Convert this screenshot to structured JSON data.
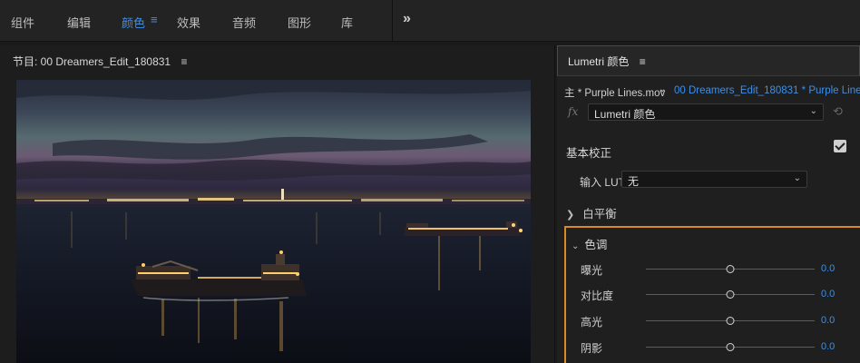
{
  "workspaces": {
    "tabs": [
      {
        "label": "组件"
      },
      {
        "label": "编辑"
      },
      {
        "label": "颜色"
      },
      {
        "label": "效果"
      },
      {
        "label": "音频"
      },
      {
        "label": "图形"
      },
      {
        "label": "库"
      }
    ],
    "active_index": 2,
    "menu_glyph": "≡",
    "more_glyph": "»"
  },
  "program": {
    "title": "节目: 00 Dreamers_Edit_180831",
    "menu_glyph": "≡"
  },
  "lumetri": {
    "title": "Lumetri 颜色",
    "menu_glyph": "≡",
    "master_clip": "主 * Purple Lines.mov",
    "sequence_clip": "00 Dreamers_Edit_180831 * Purple Lines...",
    "fx_label": "fx",
    "effect_select": "Lumetri 颜色",
    "basic_correction": {
      "title": "基本校正",
      "enabled": true,
      "input_lut_label": "输入 LUT",
      "input_lut_value": "无"
    },
    "white_balance": {
      "title": "白平衡"
    },
    "tone": {
      "title": "色调",
      "sliders": [
        {
          "label": "曝光",
          "value": "0.0",
          "position": 0.5
        },
        {
          "label": "对比度",
          "value": "0.0",
          "position": 0.5
        },
        {
          "label": "高光",
          "value": "0.0",
          "position": 0.5
        },
        {
          "label": "阴影",
          "value": "0.0",
          "position": 0.5
        }
      ]
    },
    "accent_color": "#d58a23",
    "link_color": "#3d8fe8"
  }
}
